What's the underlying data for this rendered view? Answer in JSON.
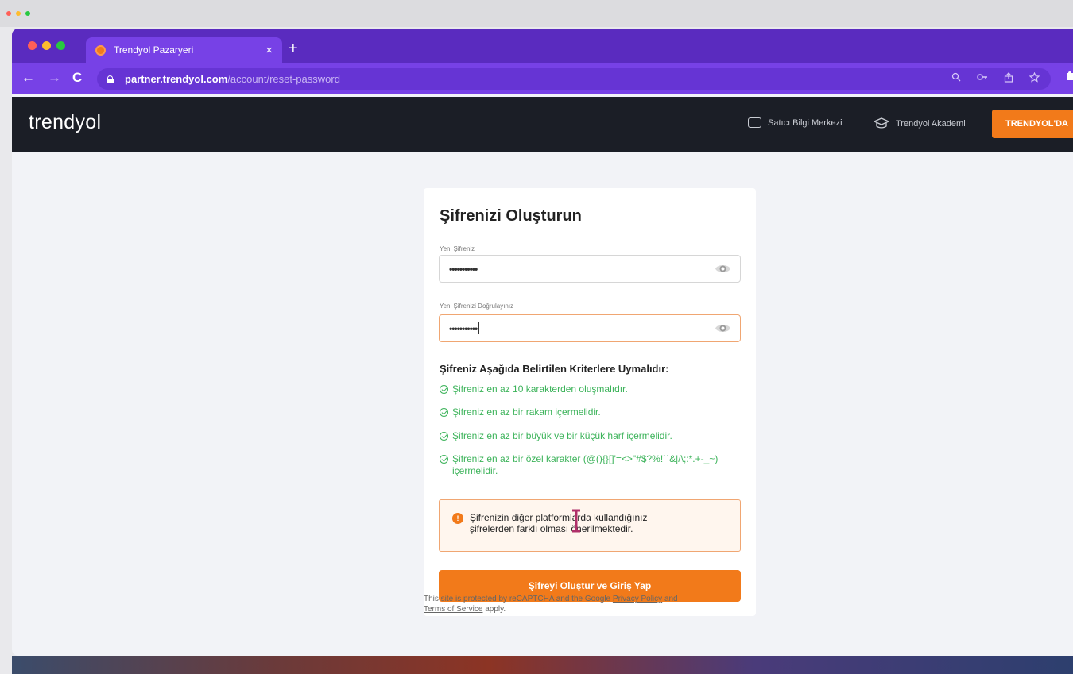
{
  "colors": {
    "tab_bar": "#5a2bbf",
    "address_bar": "#7741e6",
    "header_bg": "#1b1e26",
    "brand_orange": "#f27a1a",
    "success_green": "#3cb35a"
  },
  "browser": {
    "tab": {
      "title": "Trendyol Pazaryeri",
      "close": "×"
    },
    "new_tab": "+",
    "nav": {
      "back": "←",
      "forward": "→",
      "reload": "C"
    },
    "url": {
      "host": "partner.trendyol.com",
      "path": "/account/reset-password"
    },
    "toolbar_icons": [
      "search-icon",
      "key-icon",
      "share-icon",
      "star-icon",
      "extension-icon"
    ]
  },
  "header": {
    "brand": "trendyol",
    "links": [
      {
        "label": "Satıcı Bilgi Merkezi",
        "icon": "chat-icon"
      },
      {
        "label": "Trendyol Akademi",
        "icon": "graduation-cap-icon"
      }
    ],
    "cta": "TRENDYOL'DA"
  },
  "form": {
    "title": "Şifrenizi Oluşturun",
    "new_password": {
      "label": "Yeni Şifreniz",
      "value": "•••••••••••"
    },
    "confirm_password": {
      "label": "Yeni Şifrenizi Doğrulayınız",
      "value": "•••••••••••"
    },
    "criteria_title": "Şifreniz Aşağıda Belirtilen Kriterlere Uymalıdır:",
    "criteria": [
      "Şifreniz en az 10 karakterden oluşmalıdır.",
      "Şifreniz en az bir rakam içermelidir.",
      "Şifreniz en az bir büyük ve bir küçük harf içermelidir.",
      "Şifreniz en az bir özel karakter (@(){}[]'=<>\"#$?%!`´&|/\\;:*.+-_~) içermelidir."
    ],
    "warning": "Şifrenizin diğer platformlarda kullandığınız şifrelerden farklı olması önerilmektedir.",
    "warning_icon": "!",
    "submit": "Şifreyi Oluştur ve Giriş Yap"
  },
  "recaptcha": {
    "prefix": "This site is protected by reCAPTCHA and the Google",
    "privacy": "Privacy Policy",
    "and": "and",
    "terms": "Terms of Service",
    "suffix": "apply."
  }
}
